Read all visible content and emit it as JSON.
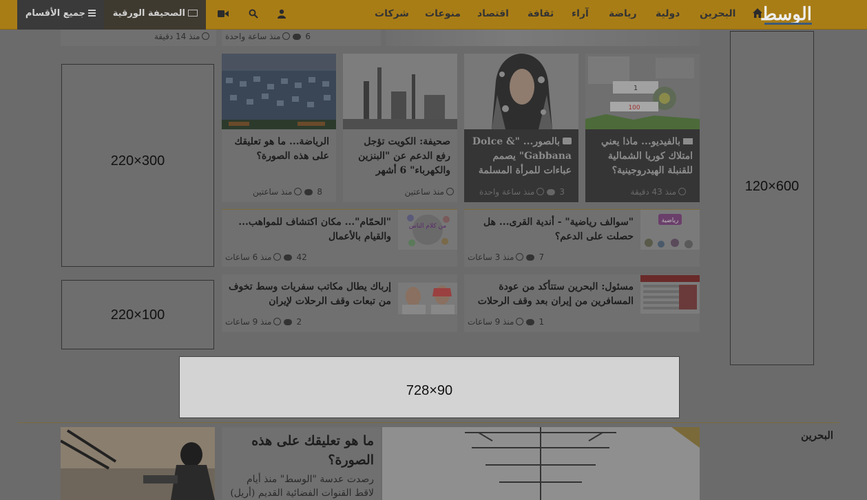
{
  "nav": {
    "logo": "الوسط",
    "items": [
      "البحرين",
      "دولية",
      "رياضة",
      "آراء",
      "ثقافة",
      "اقتصاد",
      "منوعات",
      "شركات"
    ],
    "paper": "الصحيفة الورقية",
    "all_sections": "جميع الأقسام",
    "icons": [
      "home-icon",
      "user-icon",
      "search-icon",
      "video-icon",
      "newspaper-icon",
      "menu-icon"
    ]
  },
  "top_strip": [
    {
      "time": "منذ 14 دقيقة",
      "comments": ""
    },
    {
      "time": "منذ ساعة واحدة",
      "comments": "6"
    }
  ],
  "grid": [
    {
      "title": "بالفيديو... ماذا يعني امتلاك كوريا الشمالية للقنبلة الهيدروجينية؟",
      "time": "منذ 43 دقيقة",
      "comments": "",
      "badge": "video"
    },
    {
      "title": "بالصور... \"Dolce & Gabbana\" يصمم عباءات للمرأة المسلمة",
      "time": "منذ ساعة واحدة",
      "comments": "3",
      "badge": "camera"
    },
    {
      "title": "صحيفة: الكويت تؤجل رفع الدعم عن \"البنزين والكهرباء\" 6 أشهر",
      "time": "منذ ساعتين",
      "comments": ""
    },
    {
      "title": "الرياضة... ما هو تعليقك على هذه الصورة؟",
      "time": "منذ ساعتين",
      "comments": "8"
    }
  ],
  "list": [
    {
      "title": "\"سوالف رياضية\" - أندية القرى... هل حصلت على الدعم؟",
      "time": "منذ 3 ساعات",
      "comments": "7",
      "thumb_text": "رياضية"
    },
    {
      "title": "\"الحمّام\"... مكان اكتشاف للمواهب... والقيام بالأعمال",
      "time": "منذ 6 ساعات",
      "comments": "42",
      "thumb_text": "من كلام الناس"
    },
    {
      "title": "مسئول: البحرين ستتأكد من عودة المسافرين من إيران بعد وقف الرحلات",
      "time": "منذ 9 ساعات",
      "comments": "1"
    },
    {
      "title": "إرباك يطال مكاتب سفريات وسط تخوف من تبعات وقف الرحلات لإيران",
      "time": "منذ 9 ساعات",
      "comments": "2"
    }
  ],
  "ads": {
    "skyscraper": "120×600",
    "rect_tall": "220×300",
    "rect_short": "220×100",
    "leaderboard": "728×90"
  },
  "bahrain": {
    "section_label": "البحرين",
    "headline": "ما هو تعليقك على هذه الصورة؟",
    "excerpt": "رصدت عدسة \"الوسط\" منذ أيام لاقط القنوات الفضائية القديم (أريل)"
  },
  "colors": {
    "nav_bg": "#a97d16",
    "overlay_bg": "#6b6b6b",
    "ad_light": "#d3d3d3"
  }
}
